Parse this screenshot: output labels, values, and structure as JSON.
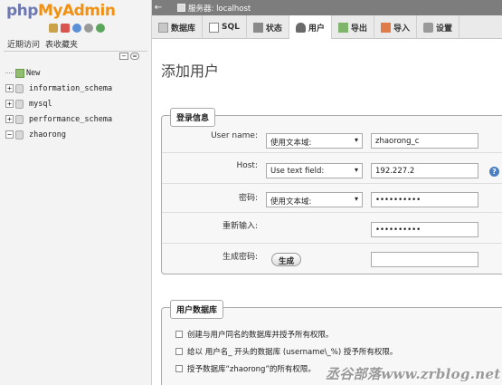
{
  "logo": {
    "php": "php",
    "my": "My",
    "admin": "Admin"
  },
  "sidebar": {
    "tabs": [
      "近期访问",
      "表收藏夹"
    ],
    "tree": [
      "New",
      "information_schema",
      "mysql",
      "performance_schema",
      "zhaorong"
    ]
  },
  "topbar": {
    "server": "服务器: localhost"
  },
  "menu": [
    "数据库",
    "SQL",
    "状态",
    "用户",
    "导出",
    "导入",
    "设置"
  ],
  "page": {
    "title": "添加用户"
  },
  "login": {
    "legend": "登录信息",
    "user_label": "User name:",
    "user_select": "使用文本域:",
    "user_value": "zhaorong_c",
    "host_label": "Host:",
    "host_select": "Use text field:",
    "host_value": "192.227.2",
    "pass_label": "密码:",
    "pass_select": "使用文本域:",
    "pass_value": "••••••••••",
    "repeat_label": "重新输入:",
    "repeat_value": "••••••••••",
    "gen_label": "生成密码:",
    "gen_button": "生成"
  },
  "userdb": {
    "legend": "用户数据库",
    "opt1": "创建与用户同名的数据库并授予所有权限。",
    "opt2": "给以 用户名_ 开头的数据库 (username\\_%) 授予所有权限。",
    "opt3": "授予数据库“zhaorong”的所有权限。"
  },
  "watermark": "丞谷部落www.zrblog.net"
}
